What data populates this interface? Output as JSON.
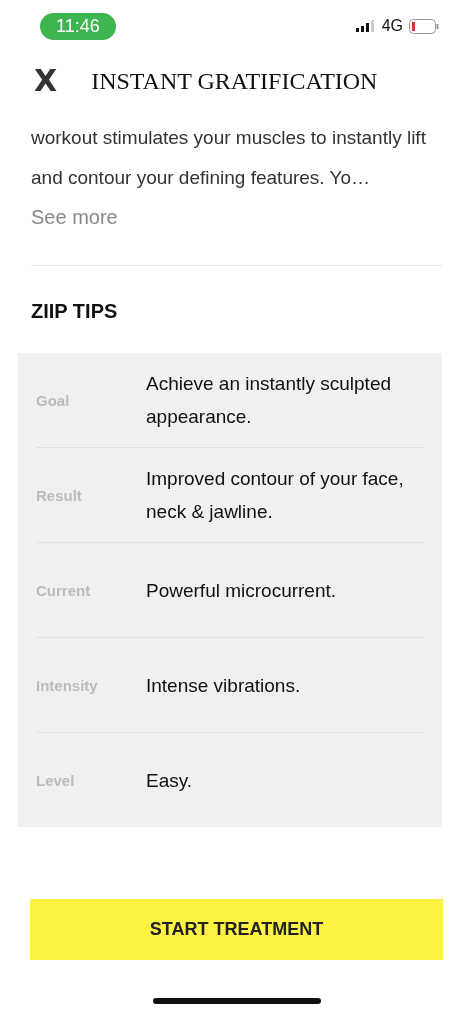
{
  "status_bar": {
    "time": "11:46",
    "network": "4G"
  },
  "header": {
    "title": "INSTANT GRATIFICATION",
    "close": "X"
  },
  "description": {
    "text": "workout stimulates your muscles to instantly lift and contour your defining features. Yo…",
    "see_more": "See more"
  },
  "tips": {
    "heading": "ZIIP TIPS",
    "rows": [
      {
        "label": "Goal",
        "value": "Achieve an instantly sculpted appearance."
      },
      {
        "label": "Result",
        "value": "Improved contour of your face, neck & jawline."
      },
      {
        "label": "Current",
        "value": "Powerful microcurrent."
      },
      {
        "label": "Intensity",
        "value": "Intense vibrations."
      },
      {
        "label": "Level",
        "value": "Easy."
      }
    ]
  },
  "button": "START TREATMENT"
}
